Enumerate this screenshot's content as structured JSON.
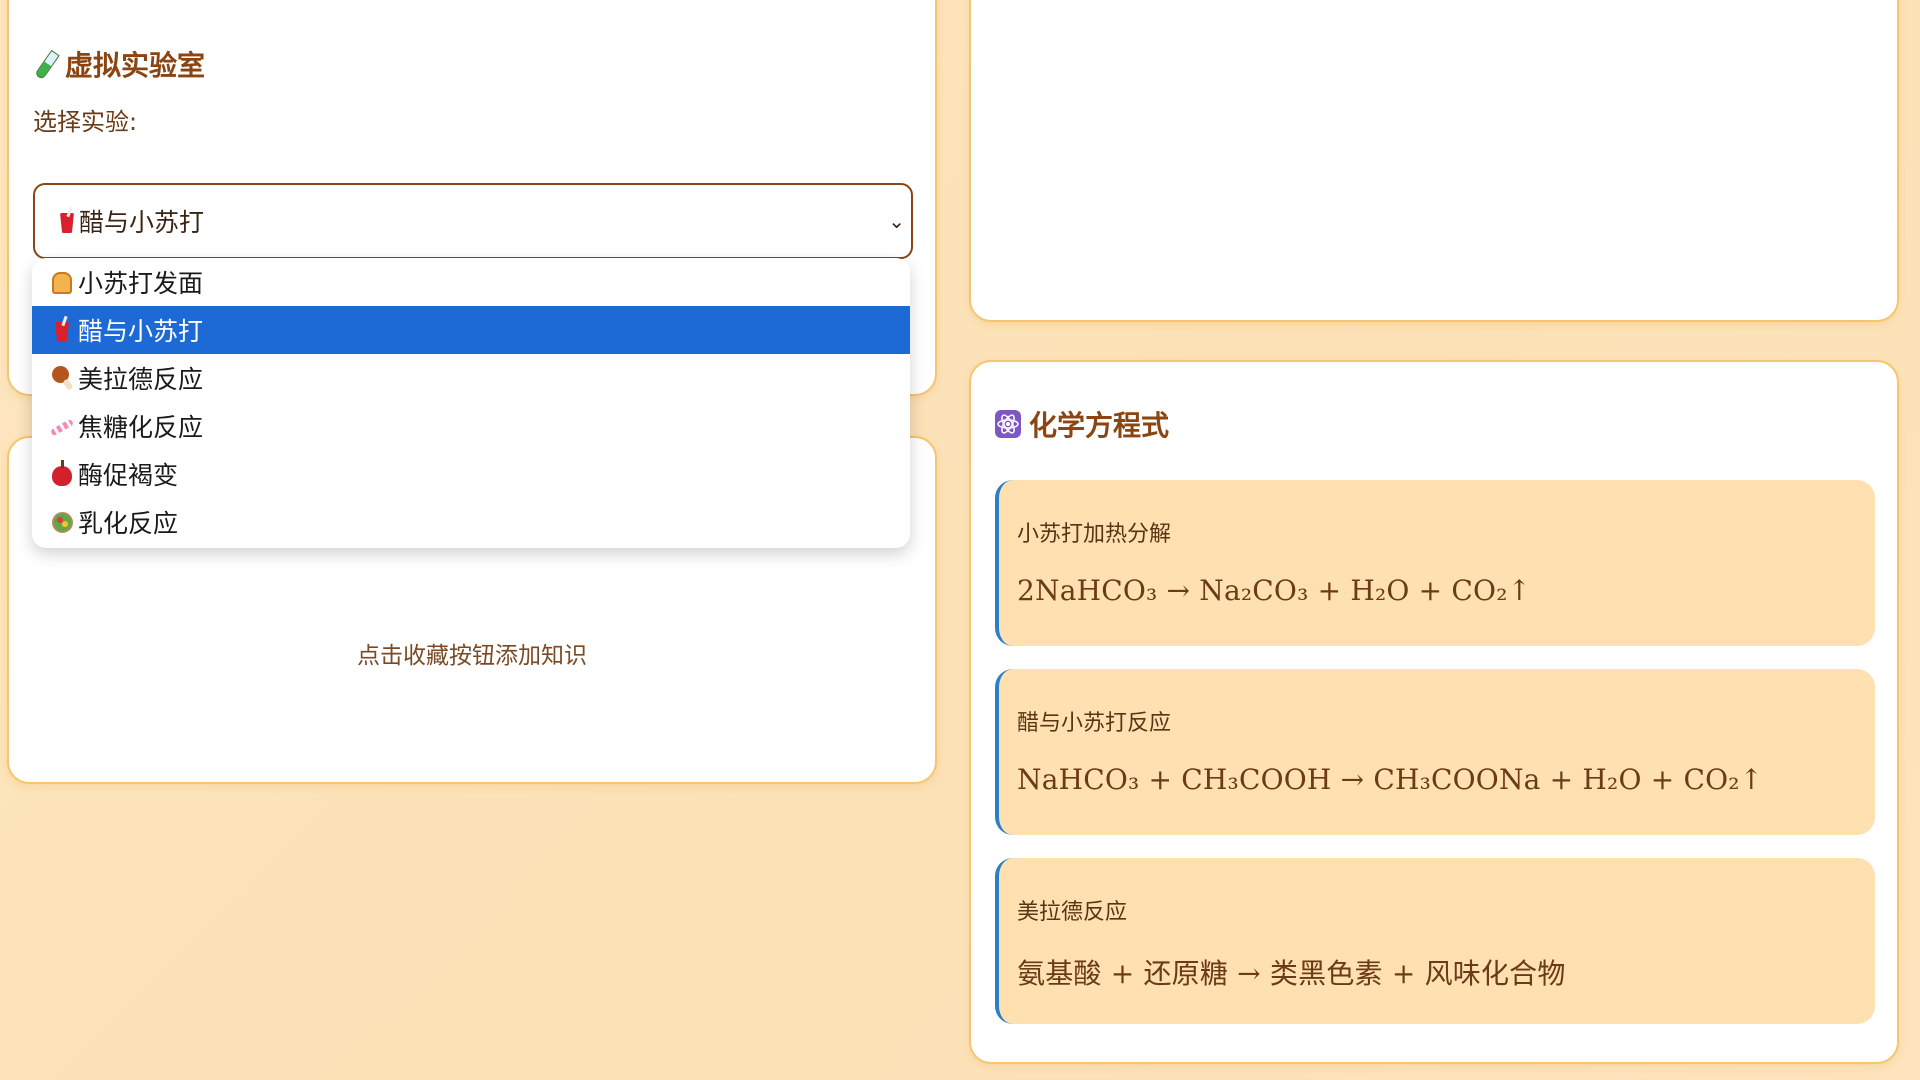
{
  "lab": {
    "title": "虚拟实验室",
    "select_label": "选择实验:",
    "selected": "醋与小苏打",
    "options": [
      {
        "label": "小苏打发面",
        "icon": "bread-icon"
      },
      {
        "label": "醋与小苏打",
        "icon": "cup-icon"
      },
      {
        "label": "美拉德反应",
        "icon": "meat-icon"
      },
      {
        "label": "焦糖化反应",
        "icon": "candy-icon"
      },
      {
        "label": "酶促褐变",
        "icon": "apple-icon"
      },
      {
        "label": "乳化反应",
        "icon": "salad-icon"
      }
    ],
    "selected_index": 1,
    "title_icon": "test-tube-icon"
  },
  "favorites": {
    "empty_text": "点击收藏按钮添加知识"
  },
  "equations": {
    "title": "化学方程式",
    "title_icon": "atom-icon",
    "items": [
      {
        "name": "小苏打加热分解",
        "formula": "2NaHCO₃ → Na₂CO₃ + H₂O + CO₂↑"
      },
      {
        "name": "醋与小苏打反应",
        "formula": "NaHCO₃ + CH₃COOH → CH₃COONa + H₂O + CO₂↑"
      },
      {
        "name": "美拉德反应",
        "formula": "氨基酸 + 还原糖 → 类黑色素 + 风味化合物"
      }
    ]
  },
  "colors": {
    "accent_border": "#f6c56f",
    "title_brown": "#8a4512",
    "selected_option": "#1d6ad6",
    "equation_bg": "#ffe0b0",
    "equation_bar": "#2a7fc6"
  }
}
